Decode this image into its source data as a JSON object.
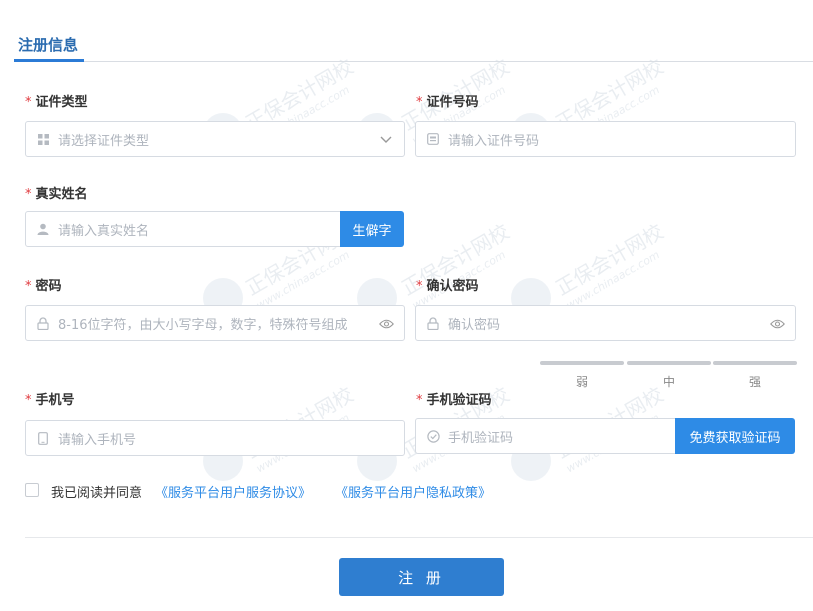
{
  "section": {
    "title": "注册信息"
  },
  "form": {
    "required_mark": "*",
    "id_type": {
      "label": "证件类型",
      "placeholder": "请选择证件类型"
    },
    "id_number": {
      "label": "证件号码",
      "placeholder": "请输入证件号码"
    },
    "real_name": {
      "label": "真实姓名",
      "placeholder": "请输入真实姓名",
      "button": "生僻字"
    },
    "password": {
      "label": "密码",
      "placeholder": "8-16位字符，由大小写字母，数字，特殊符号组成"
    },
    "confirm_password": {
      "label": "确认密码",
      "placeholder": "确认密码"
    },
    "strength": {
      "weak": "弱",
      "medium": "中",
      "strong": "强"
    },
    "phone": {
      "label": "手机号",
      "placeholder": "请输入手机号"
    },
    "sms_code": {
      "label": "手机验证码",
      "placeholder": "手机验证码",
      "button": "免费获取验证码"
    }
  },
  "agreement": {
    "checked": false,
    "text": "我已阅读并同意",
    "link_service": "《服务平台用户服务协议》",
    "link_privacy": "《服务平台用户隐私政策》"
  },
  "submit": {
    "label": "注 册"
  },
  "watermark": {
    "brand": "正保会计网校",
    "url": "www.chinaacc.com"
  },
  "colors": {
    "primary": "#2e8be6",
    "required": "#e0393e",
    "title": "#2b6cb0"
  },
  "icons": {
    "id_type": "grid-icon",
    "id_number": "id-card-icon",
    "real_name": "user-icon",
    "password": "lock-icon",
    "confirm": "lock-icon",
    "eye": "eye-icon",
    "phone": "phone-icon",
    "sms": "check-circle-icon",
    "dropdown": "chevron-down-icon"
  }
}
